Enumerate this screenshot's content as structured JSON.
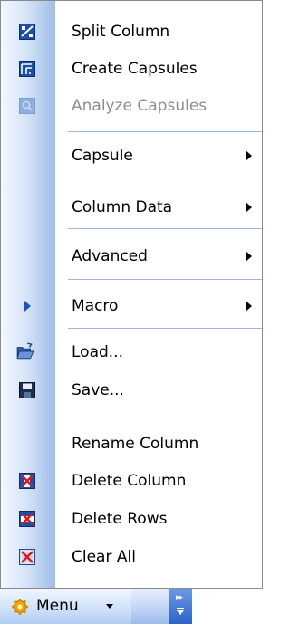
{
  "menu": {
    "items": [
      {
        "label": "Split Column",
        "icon": "split-column-icon",
        "disabled": false,
        "submenu": false
      },
      {
        "label": "Create Capsules",
        "icon": "create-capsules-icon",
        "disabled": false,
        "submenu": false
      },
      {
        "label": "Analyze Capsules",
        "icon": "analyze-capsules-icon",
        "disabled": true,
        "submenu": false
      },
      {
        "label": "Capsule",
        "icon": null,
        "disabled": false,
        "submenu": true
      },
      {
        "label": "Column Data",
        "icon": null,
        "disabled": false,
        "submenu": true
      },
      {
        "label": "Advanced",
        "icon": null,
        "disabled": false,
        "submenu": true
      },
      {
        "label": "Macro",
        "icon": "play-arrow-icon",
        "disabled": false,
        "submenu": true
      },
      {
        "label": "Load...",
        "icon": "open-folder-icon",
        "disabled": false,
        "submenu": false
      },
      {
        "label": "Save...",
        "icon": "floppy-disk-icon",
        "disabled": false,
        "submenu": false
      },
      {
        "label": "Rename Column",
        "icon": null,
        "disabled": false,
        "submenu": false
      },
      {
        "label": "Delete Column",
        "icon": "delete-column-icon",
        "disabled": false,
        "submenu": false
      },
      {
        "label": "Delete Rows",
        "icon": "delete-rows-icon",
        "disabled": false,
        "submenu": false
      },
      {
        "label": "Clear All",
        "icon": "clear-all-icon",
        "disabled": false,
        "submenu": false
      }
    ]
  },
  "toolbar": {
    "menu_label": "Menu",
    "menu_icon": "gear-icon",
    "overflow_icon": "chevron-overflow-icon"
  },
  "colors": {
    "gutter_dark": "#9fbde8",
    "separator": "#9db7e1",
    "disabled_text": "#8d8d8d",
    "toolbar_grip": "#2e63c6"
  }
}
